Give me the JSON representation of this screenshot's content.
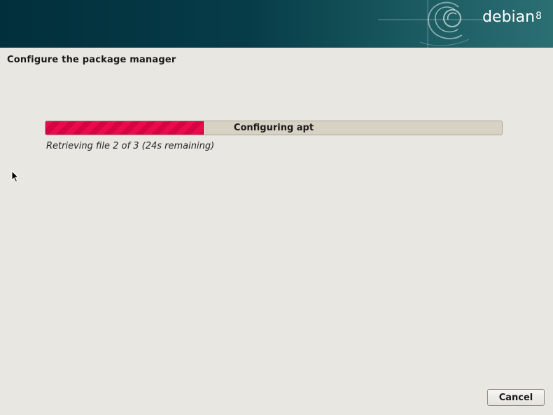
{
  "banner": {
    "logo_text": "debian",
    "version": "8"
  },
  "page": {
    "title": "Configure the package manager"
  },
  "progress": {
    "label": "Configuring apt",
    "fraction": 0.345,
    "status_text": "Retrieving file 2 of 3 (24s remaining)",
    "fill_color": "#e80c4c"
  },
  "buttons": {
    "cancel_label": "Cancel"
  },
  "colors": {
    "banner_dark": "#022f3c",
    "banner_light": "#2c6f73",
    "background": "#e8e7e2",
    "progress_track": "#d8d2c4"
  },
  "icons": {
    "cursor": "mouse-pointer-icon",
    "swirl": "debian-swirl-icon"
  }
}
